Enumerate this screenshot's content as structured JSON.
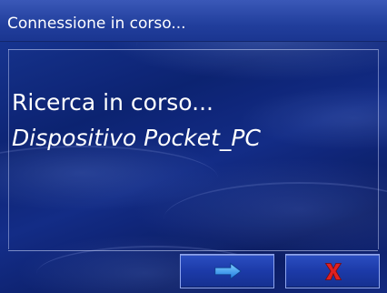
{
  "dialog": {
    "title": "Connessione in corso...",
    "status": "Ricerca in corso...",
    "device": "Dispositivo Pocket_PC"
  },
  "buttons": {
    "next_icon": "arrow-right-icon",
    "cancel_icon": "close-x-icon"
  },
  "colors": {
    "arrow": "#3aa0ff",
    "cancel_x": "#e02020",
    "title_text": "#ffffff"
  }
}
